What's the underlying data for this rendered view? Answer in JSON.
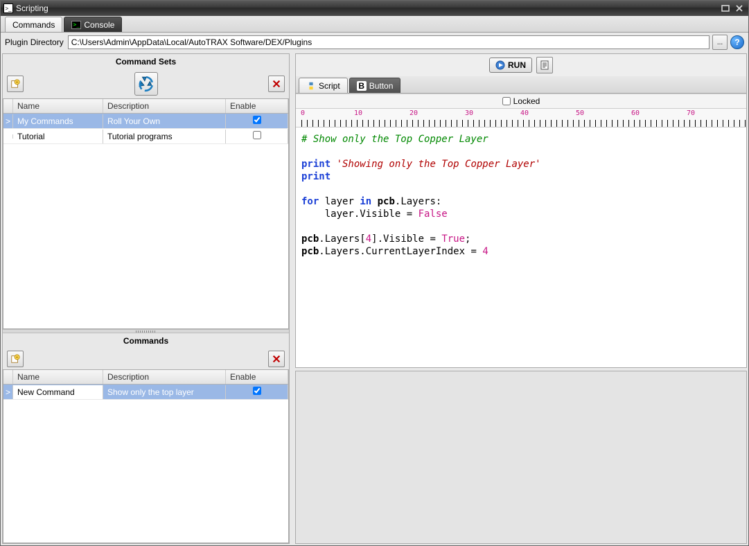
{
  "window": {
    "title": "Scripting"
  },
  "tabs": {
    "commands": "Commands",
    "console": "Console"
  },
  "plugin_dir": {
    "label": "Plugin Directory",
    "value": "C:\\Users\\Admin\\AppData\\Local/AutoTRAX Software/DEX/Plugins"
  },
  "command_sets": {
    "title": "Command Sets",
    "columns": {
      "name": "Name",
      "description": "Description",
      "enable": "Enable"
    },
    "rows": [
      {
        "name": "My Commands",
        "description": "Roll Your Own",
        "enabled": true,
        "selected": true,
        "indicator": ">"
      },
      {
        "name": "Tutorial",
        "description": "Tutorial programs",
        "enabled": false,
        "selected": false,
        "indicator": ""
      }
    ]
  },
  "commands": {
    "title": "Commands",
    "columns": {
      "name": "Name",
      "description": "Description",
      "enable": "Enable"
    },
    "rows": [
      {
        "name": "New Command",
        "description": "Show only the top layer",
        "enabled": true,
        "selected": true,
        "indicator": ">"
      }
    ]
  },
  "run": {
    "label": "RUN"
  },
  "sub_tabs": {
    "script": "Script",
    "button": "Button"
  },
  "locked": {
    "label": "Locked",
    "checked": false
  },
  "ruler_ticks": [
    0,
    10,
    20,
    30,
    40,
    50,
    60,
    70
  ],
  "code": {
    "l1_comment": "# Show only the Top Copper Layer",
    "l2_kw": "print ",
    "l2_str": "'Showing only the Top Copper Layer'",
    "l3": "print",
    "l4_for": "for",
    "l4_mid": " layer ",
    "l4_in": "in",
    "l4_pcb": " pcb",
    "l4_rest": ".Layers:",
    "l5_a": "    layer.Visible = ",
    "l5_b": "False",
    "l6_a": "pcb",
    "l6_b": ".Layers[",
    "l6_c": "4",
    "l6_d": "].Visible = ",
    "l6_e": "True",
    "l6_f": ";",
    "l7_a": "pcb",
    "l7_b": ".Layers.CurrentLayerIndex = ",
    "l7_c": "4"
  }
}
